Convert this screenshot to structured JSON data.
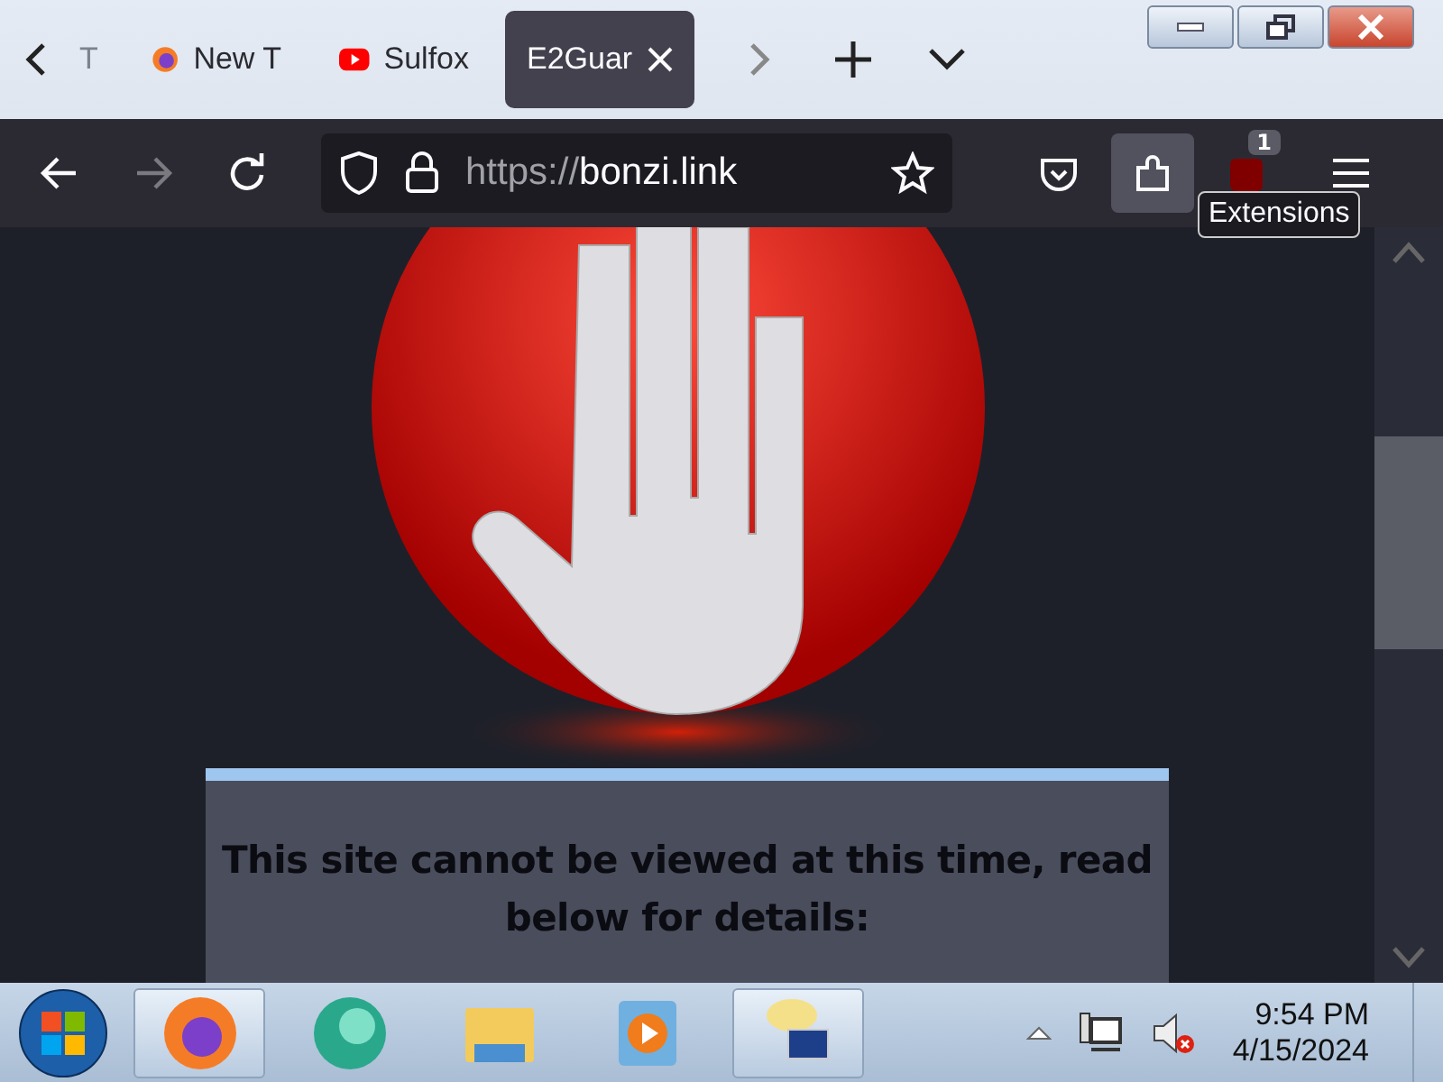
{
  "tabs": [
    {
      "label": "T",
      "kind": "faded",
      "selected": false
    },
    {
      "label": "New T",
      "kind": "firefox",
      "selected": false
    },
    {
      "label": "Sulfox",
      "kind": "video",
      "selected": false
    },
    {
      "label": "E2Guar",
      "kind": "plain",
      "selected": true
    }
  ],
  "toolbar": {
    "url_scheme": "https://",
    "url_host": "bonzi.link",
    "forward_disabled": true,
    "extensions_badge": "1",
    "tooltip": "Extensions"
  },
  "page": {
    "message": "This site cannot be viewed at this time, read below for details:"
  },
  "taskbar": {
    "apps": [
      {
        "kind": "firefox",
        "active": true
      },
      {
        "kind": "globe",
        "active": false
      },
      {
        "kind": "folder",
        "active": false
      },
      {
        "kind": "player",
        "active": false
      },
      {
        "kind": "network",
        "active": true
      }
    ],
    "time": "9:54 PM",
    "date": "4/15/2024"
  }
}
